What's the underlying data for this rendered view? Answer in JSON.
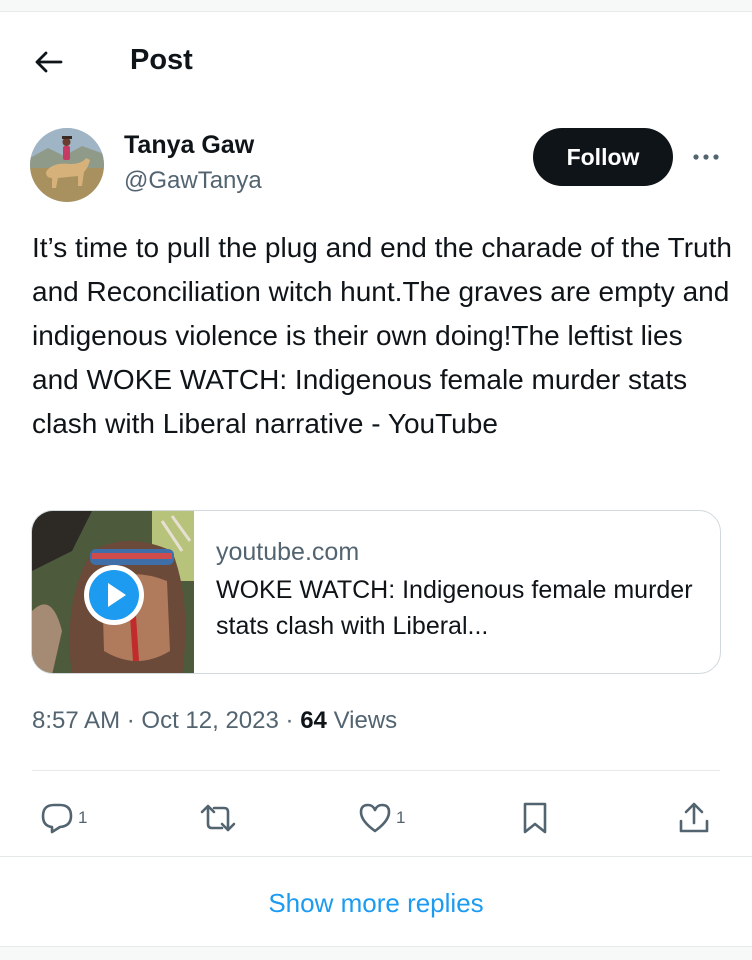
{
  "header": {
    "title": "Post",
    "back_icon": "arrow-left-icon"
  },
  "author": {
    "name": "Tanya Gaw",
    "handle": "@GawTanya",
    "follow_label": "Follow",
    "more_icon": "ellipsis-icon",
    "avatar": "horse-rider-avatar"
  },
  "tweet": {
    "text": "It’s time to pull the plug and end the charade of the Truth and Reconciliation witch hunt.The graves are empty and indigenous violence is their own doing!The leftist lies and WOKE WATCH: Indigenous female murder stats clash with Liberal narrative - YouTube"
  },
  "link_card": {
    "domain": "youtube.com",
    "title": "WOKE WATCH: Indigenous female murder stats clash with Liberal...",
    "play_icon": "play-icon"
  },
  "meta": {
    "time": "8:57 AM",
    "separator": "·",
    "date": "Oct 12, 2023",
    "views_count": "64",
    "views_label": "Views"
  },
  "actions": {
    "reply_count": "1",
    "retweet_count": "",
    "like_count": "1",
    "icons": [
      "reply-icon",
      "retweet-icon",
      "like-icon",
      "bookmark-icon",
      "share-icon"
    ]
  },
  "show_more_label": "Show more replies",
  "colors": {
    "accent": "#1d9bf0",
    "text": "#0f1419",
    "secondary": "#536471",
    "border": "#cfd9de"
  }
}
